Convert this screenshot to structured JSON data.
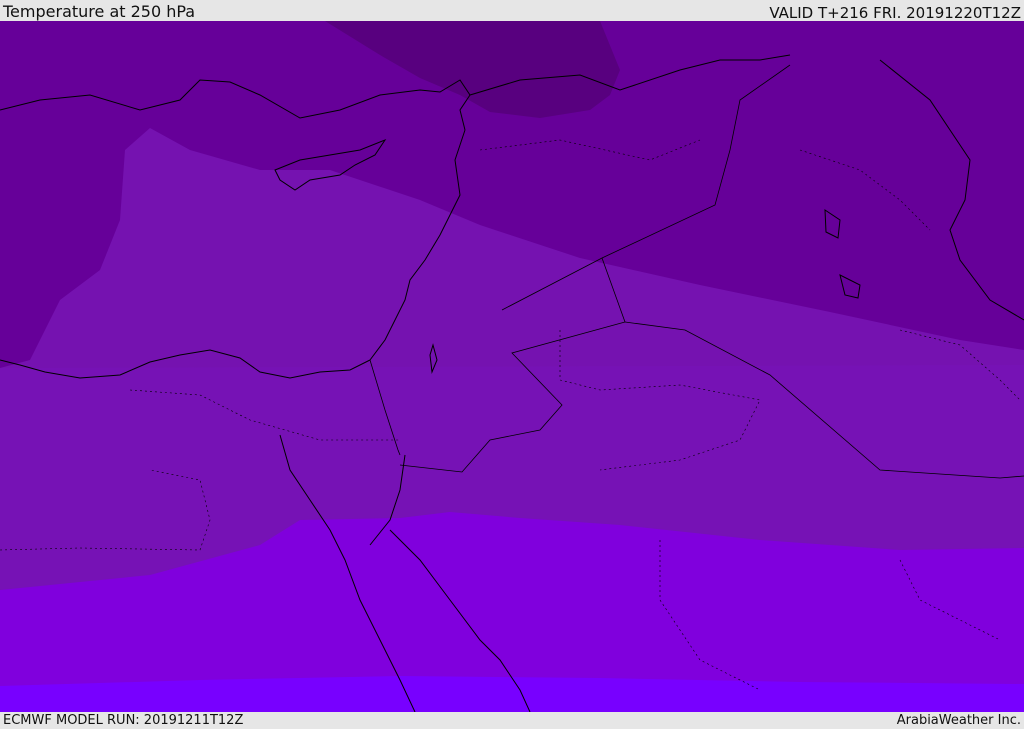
{
  "header": {
    "title": "Temperature at 250 hPa",
    "valid": "VALID T+216 FRI. 20191220T12Z"
  },
  "footer": {
    "model_run": "ECMWF MODEL RUN: 20191211T12Z",
    "credit": "ArabiaWeather Inc."
  },
  "colors": {
    "band_darkest": "#55007f",
    "band_dark": "#660099",
    "band_mid": "#7510b3",
    "band_mid2": "#7b12bb",
    "band_bright": "#8000dd",
    "band_brightest": "#7800ff",
    "coastline": "#000000"
  }
}
